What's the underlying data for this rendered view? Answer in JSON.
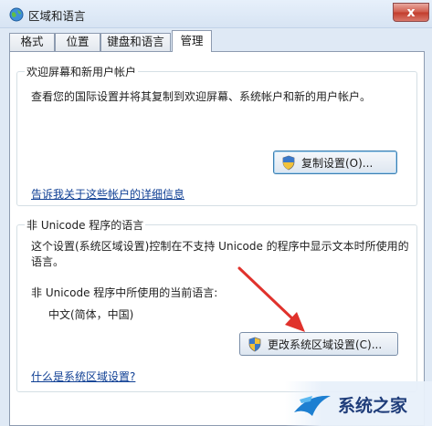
{
  "window": {
    "title": "区域和语言",
    "close_label": "x"
  },
  "tabs": [
    {
      "label": "格式",
      "active": false
    },
    {
      "label": "位置",
      "active": false
    },
    {
      "label": "键盘和语言",
      "active": false
    },
    {
      "label": "管理",
      "active": true
    }
  ],
  "welcome_group": {
    "title": "欢迎屏幕和新用户帐户",
    "description": "查看您的国际设置并将其复制到欢迎屏幕、系统帐户和新的用户帐户。",
    "copy_button": "复制设置(O)...",
    "details_link": "告诉我关于这些帐户的详细信息"
  },
  "unicode_group": {
    "title": "非 Unicode 程序的语言",
    "description": "这个设置(系统区域设置)控制在不支持 Unicode 的程序中显示文本时所使用的语言。",
    "current_label": "非 Unicode 程序中所使用的当前语言:",
    "current_value": "中文(简体，中国)",
    "change_button": "更改系统区域设置(C)...",
    "help_link": "什么是系统区域设置?"
  },
  "watermark": {
    "text": "系统之家"
  },
  "colors": {
    "annotation_arrow": "#e0322c",
    "link": "#0f3f94",
    "watermark": "#1f3d7a"
  }
}
